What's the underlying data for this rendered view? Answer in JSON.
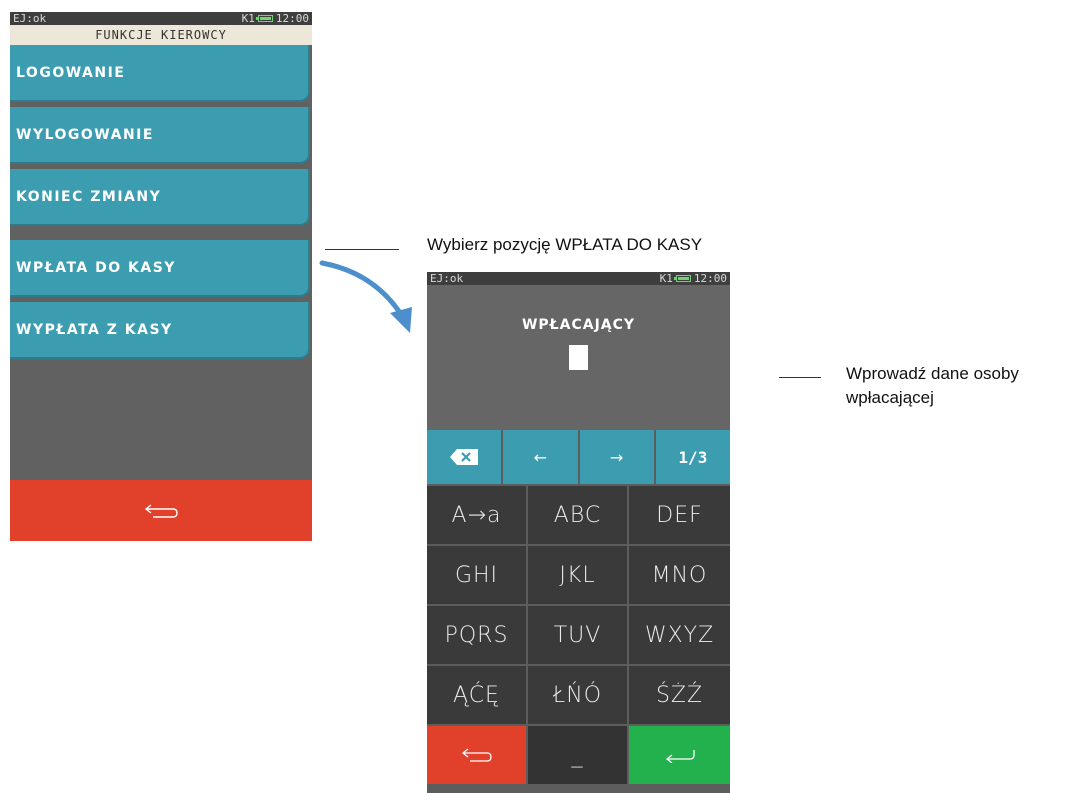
{
  "screen1": {
    "status": {
      "ej": "EJ:ok",
      "k": "K1",
      "time": "12:00"
    },
    "title": "FUNKCJE KIEROWCY",
    "menu": [
      {
        "label": "LOGOWANIE"
      },
      {
        "label": "WYLOGOWANIE"
      },
      {
        "label": "KONIEC ZMIANY"
      },
      {
        "label": "WPŁATA DO KASY"
      },
      {
        "label": "WYPŁATA Z KASY"
      }
    ],
    "back_icon": "back-arrow-icon"
  },
  "captions": {
    "step1": "Wybierz pozycję WPŁATA DO KASY",
    "step2_line1": "Wprowadź dane osoby",
    "step2_line2": "wpłacającej"
  },
  "screen2": {
    "status": {
      "ej": "EJ:ok",
      "k": "K1",
      "time": "12:00"
    },
    "entry_label": "WPŁACAJĄCY",
    "toolbar": {
      "left_arrow": "←",
      "right_arrow": "→",
      "page": "1/3"
    },
    "keys": [
      "A→a",
      "ABC",
      "DEF",
      "GHI",
      "JKL",
      "MNO",
      "PQRS",
      "TUV",
      "WXYZ",
      "ĄĆĘ",
      "ŁŃÓ",
      "ŚŻŹ"
    ],
    "bottom": {
      "space": "_"
    }
  },
  "colors": {
    "menu_button": "#3d9db0",
    "back_red": "#e1412b",
    "enter_green": "#22b14c",
    "key_dark": "#3a3a3a"
  }
}
